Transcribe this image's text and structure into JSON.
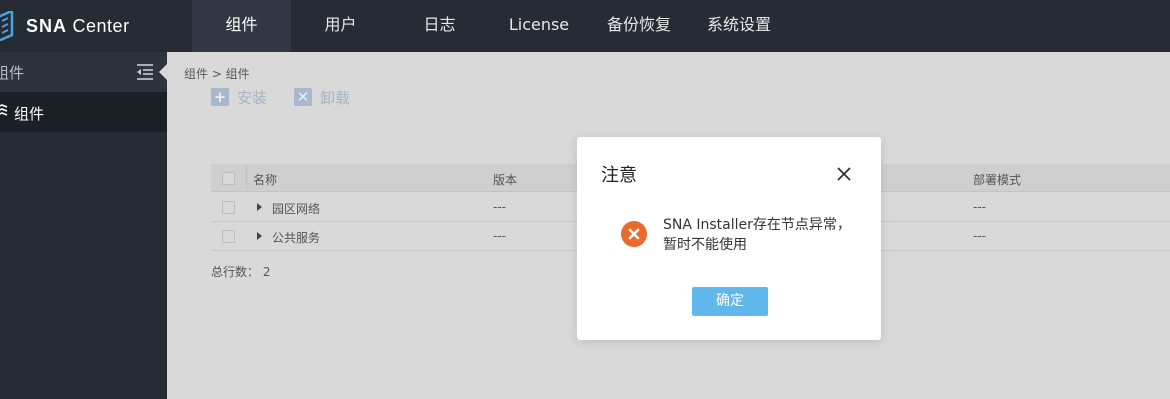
{
  "app": {
    "logo_brand": "SNA",
    "logo_suffix": "Center"
  },
  "nav": {
    "items": [
      {
        "label": "组件",
        "active": true
      },
      {
        "label": "用户",
        "active": false
      },
      {
        "label": "日志",
        "active": false
      },
      {
        "label": "License",
        "active": false
      },
      {
        "label": "备份恢复",
        "active": false
      },
      {
        "label": "系统设置",
        "active": false
      }
    ]
  },
  "sidebar": {
    "title": "组件",
    "items": [
      {
        "label": "组件",
        "selected": true
      }
    ]
  },
  "breadcrumb": "组件 > 组件",
  "toolbar": {
    "install_label": "安装",
    "uninstall_label": "卸载"
  },
  "table": {
    "columns": [
      "名称",
      "版本",
      "部署模式"
    ],
    "rows": [
      {
        "name": "园区网络",
        "version": "---",
        "deploy_mode": "---"
      },
      {
        "name": "公共服务",
        "version": "---",
        "deploy_mode": "---"
      }
    ],
    "total_label": "总行数：",
    "total_value": "2"
  },
  "dialog": {
    "title": "注意",
    "message": "SNA Installer存在节点异常，暂时不能使用",
    "ok_label": "确定",
    "icon": "error-icon"
  },
  "colors": {
    "nav_bg": "#262b34",
    "error_icon": "#ea6a2b",
    "primary_button": "#5fb7ec"
  }
}
